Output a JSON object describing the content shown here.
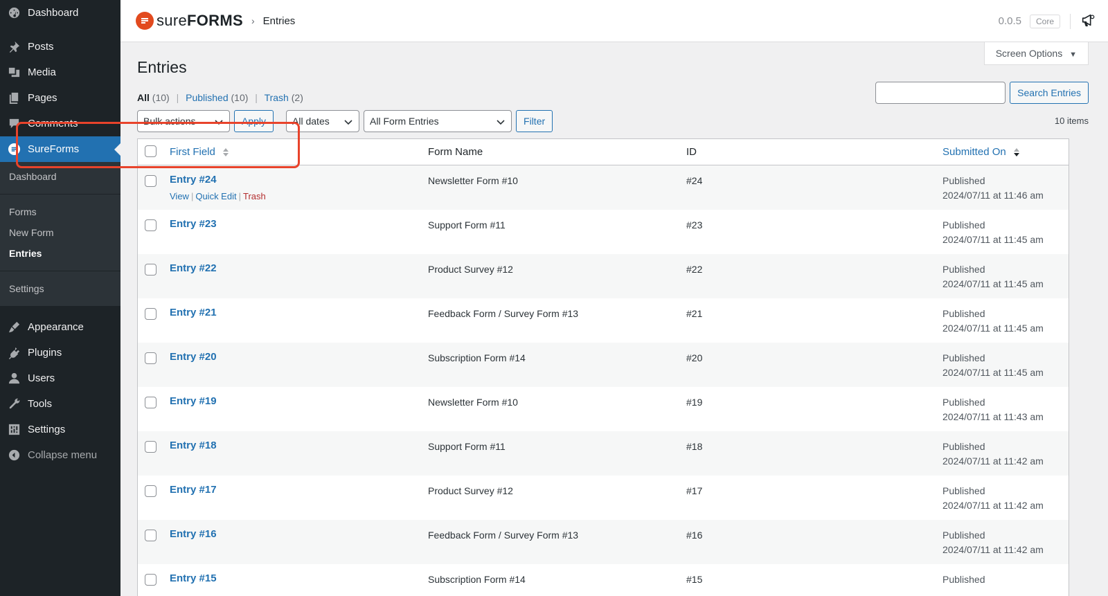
{
  "sidebar": {
    "items_top": [
      {
        "label": "Dashboard",
        "icon": "dashboard-icon"
      },
      {
        "label": "Posts",
        "icon": "pin-icon"
      },
      {
        "label": "Media",
        "icon": "media-icon"
      },
      {
        "label": "Pages",
        "icon": "pages-icon"
      },
      {
        "label": "Comments",
        "icon": "comment-icon"
      },
      {
        "label": "SureForms",
        "icon": "sureforms-icon"
      }
    ],
    "submenu": {
      "dashboard": "Dashboard",
      "forms": "Forms",
      "new_form": "New Form",
      "entries": "Entries",
      "settings": "Settings"
    },
    "items_bottom": [
      {
        "label": "Appearance",
        "icon": "brush-icon"
      },
      {
        "label": "Plugins",
        "icon": "plug-icon"
      },
      {
        "label": "Users",
        "icon": "user-icon"
      },
      {
        "label": "Tools",
        "icon": "wrench-icon"
      },
      {
        "label": "Settings",
        "icon": "settings-icon"
      }
    ],
    "collapse": "Collapse menu"
  },
  "header": {
    "brand_light": "sure",
    "brand_bold": "FORMS",
    "breadcrumb_sep": "›",
    "breadcrumb": "Entries",
    "version": "0.0.5",
    "badge": "Core"
  },
  "screen_options": "Screen Options",
  "page_title": "Entries",
  "views": {
    "all": "All",
    "all_count": "(10)",
    "published": "Published",
    "published_count": "(10)",
    "trash": "Trash",
    "trash_count": "(2)"
  },
  "search_button": "Search Entries",
  "bulk_actions": "Bulk actions",
  "apply": "Apply",
  "all_dates": "All dates",
  "all_form_entries": "All Form Entries",
  "filter": "Filter",
  "items_count": "10 items",
  "table": {
    "headers": {
      "first_field": "First Field",
      "form_name": "Form Name",
      "id": "ID",
      "submitted_on": "Submitted On"
    },
    "row_actions": {
      "view": "View",
      "quick_edit": "Quick Edit",
      "trash": "Trash"
    },
    "rows": [
      {
        "title": "Entry #24",
        "form": "Newsletter Form #10",
        "id": "#24",
        "status": "Published",
        "date": "2024/07/11 at 11:46 am"
      },
      {
        "title": "Entry #23",
        "form": "Support Form #11",
        "id": "#23",
        "status": "Published",
        "date": "2024/07/11 at 11:45 am"
      },
      {
        "title": "Entry #22",
        "form": "Product Survey #12",
        "id": "#22",
        "status": "Published",
        "date": "2024/07/11 at 11:45 am"
      },
      {
        "title": "Entry #21",
        "form": "Feedback Form / Survey Form #13",
        "id": "#21",
        "status": "Published",
        "date": "2024/07/11 at 11:45 am"
      },
      {
        "title": "Entry #20",
        "form": "Subscription Form #14",
        "id": "#20",
        "status": "Published",
        "date": "2024/07/11 at 11:45 am"
      },
      {
        "title": "Entry #19",
        "form": "Newsletter Form #10",
        "id": "#19",
        "status": "Published",
        "date": "2024/07/11 at 11:43 am"
      },
      {
        "title": "Entry #18",
        "form": "Support Form #11",
        "id": "#18",
        "status": "Published",
        "date": "2024/07/11 at 11:42 am"
      },
      {
        "title": "Entry #17",
        "form": "Product Survey #12",
        "id": "#17",
        "status": "Published",
        "date": "2024/07/11 at 11:42 am"
      },
      {
        "title": "Entry #16",
        "form": "Feedback Form / Survey Form #13",
        "id": "#16",
        "status": "Published",
        "date": "2024/07/11 at 11:42 am"
      },
      {
        "title": "Entry #15",
        "form": "Subscription Form #14",
        "id": "#15",
        "status": "Published",
        "date": ""
      }
    ]
  },
  "colors": {
    "sidebar_bg": "#1d2327",
    "active": "#2271b1",
    "highlight": "#e8432b",
    "brand": "#e24a1e"
  }
}
